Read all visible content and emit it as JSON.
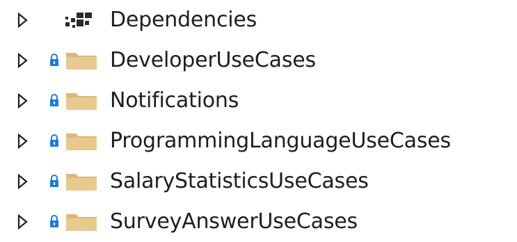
{
  "solution_explorer": {
    "items": [
      {
        "label": "Dependencies",
        "icon": "dependencies-icon",
        "expanded": false,
        "locked": false
      },
      {
        "label": "DeveloperUseCases",
        "icon": "folder-icon",
        "expanded": false,
        "locked": true
      },
      {
        "label": "Notifications",
        "icon": "folder-icon",
        "expanded": false,
        "locked": true
      },
      {
        "label": "ProgrammingLanguageUseCases",
        "icon": "folder-icon",
        "expanded": false,
        "locked": true
      },
      {
        "label": "SalaryStatisticsUseCases",
        "icon": "folder-icon",
        "expanded": false,
        "locked": true
      },
      {
        "label": "SurveyAnswerUseCases",
        "icon": "folder-icon",
        "expanded": false,
        "locked": true
      }
    ],
    "colors": {
      "text": "#1e1e1e",
      "expander": "#1e1e1e",
      "folder": "#dcb67a",
      "folder_dark": "#c9a15a",
      "lock": "#1e7bd6",
      "dependencies": "#2b2b2b"
    }
  }
}
